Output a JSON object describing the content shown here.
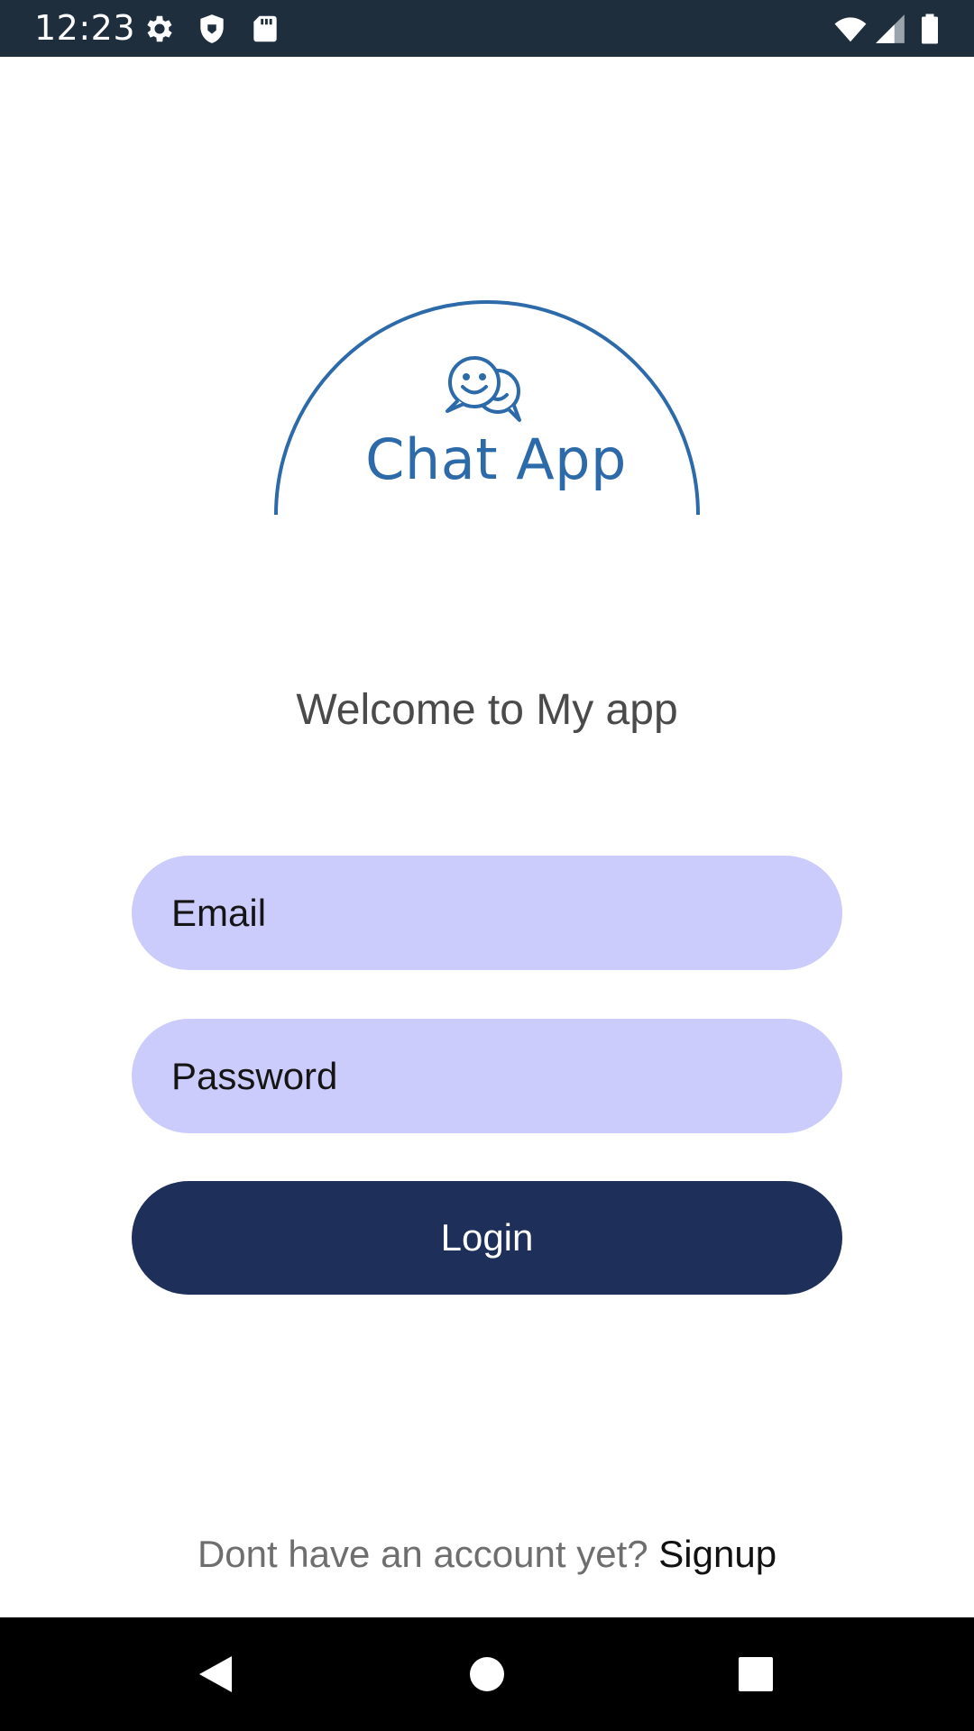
{
  "status_bar": {
    "time": "12:23",
    "left_icons": [
      "gear-icon",
      "shield-icon",
      "sd-card-icon"
    ],
    "right_icons": [
      "wifi-icon",
      "cell-signal-icon",
      "battery-icon"
    ],
    "background": "#1e2e3c"
  },
  "logo": {
    "text": "Chat App",
    "icon": "chat-faces-icon",
    "color": "#2c6aa9"
  },
  "welcome": {
    "text": "Welcome to My app"
  },
  "form": {
    "email_placeholder": "Email",
    "password_placeholder": "Password",
    "field_color": "#ccccfc",
    "login_label": "Login",
    "login_color": "#1e2f5a"
  },
  "signup": {
    "prompt": "Dont have an account yet? ",
    "link_label": "Signup"
  },
  "nav_bar": {
    "buttons": [
      "back-icon",
      "home-icon",
      "recents-icon"
    ]
  }
}
